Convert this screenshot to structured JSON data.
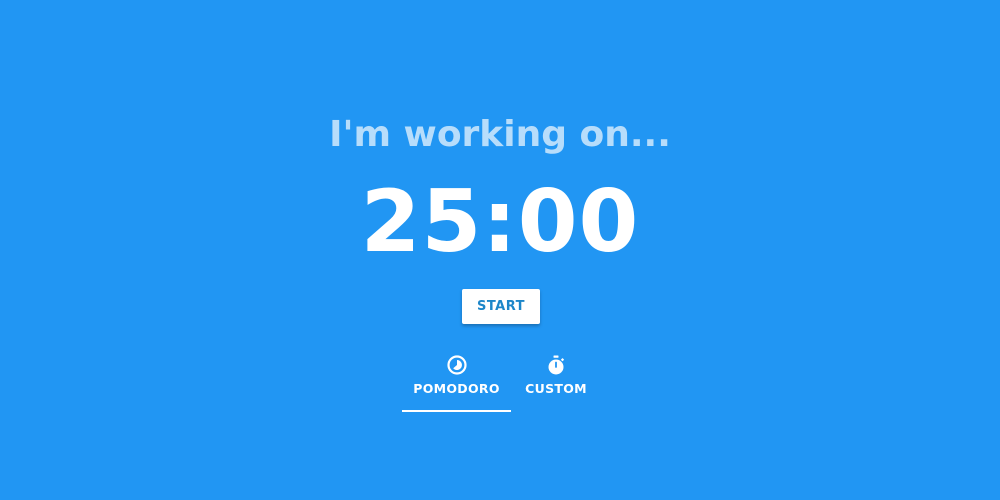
{
  "task": {
    "placeholder": "I'm working on...",
    "value": ""
  },
  "timer": {
    "display": "25:00"
  },
  "controls": {
    "start_label": "START"
  },
  "tabs": [
    {
      "label": "POMODORO",
      "icon": "pomodoro-icon",
      "active": true
    },
    {
      "label": "CUSTOM",
      "icon": "stopwatch-icon",
      "active": false
    }
  ],
  "colors": {
    "background": "#2196f3",
    "button_text": "#1d86c9",
    "text": "#ffffff"
  }
}
